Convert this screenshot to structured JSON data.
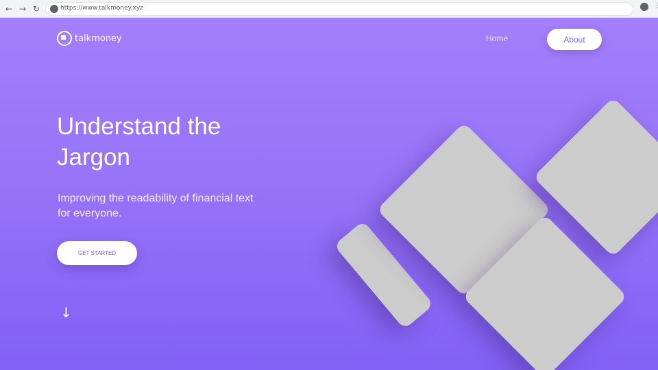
{
  "browser": {
    "url": "https://www.talkmoney.xyz",
    "back_icon": "←",
    "forward_icon": "→",
    "reload_icon": "↻",
    "menu_icon": "⋮"
  },
  "nav": {
    "logo_text": "talkmoney",
    "home_label": "Home",
    "about_label": "About"
  },
  "hero": {
    "headline": "Understand the Jargon",
    "subheadline": "Improving the readability of financial text for everyone.",
    "cta_label": "GET STARTED",
    "scroll_icon": "↓"
  },
  "colors": {
    "gradient_top": "#a47ffb",
    "gradient_bottom": "#8161f5",
    "tile": "#cccccc",
    "button_text": "#7d5ef3"
  }
}
